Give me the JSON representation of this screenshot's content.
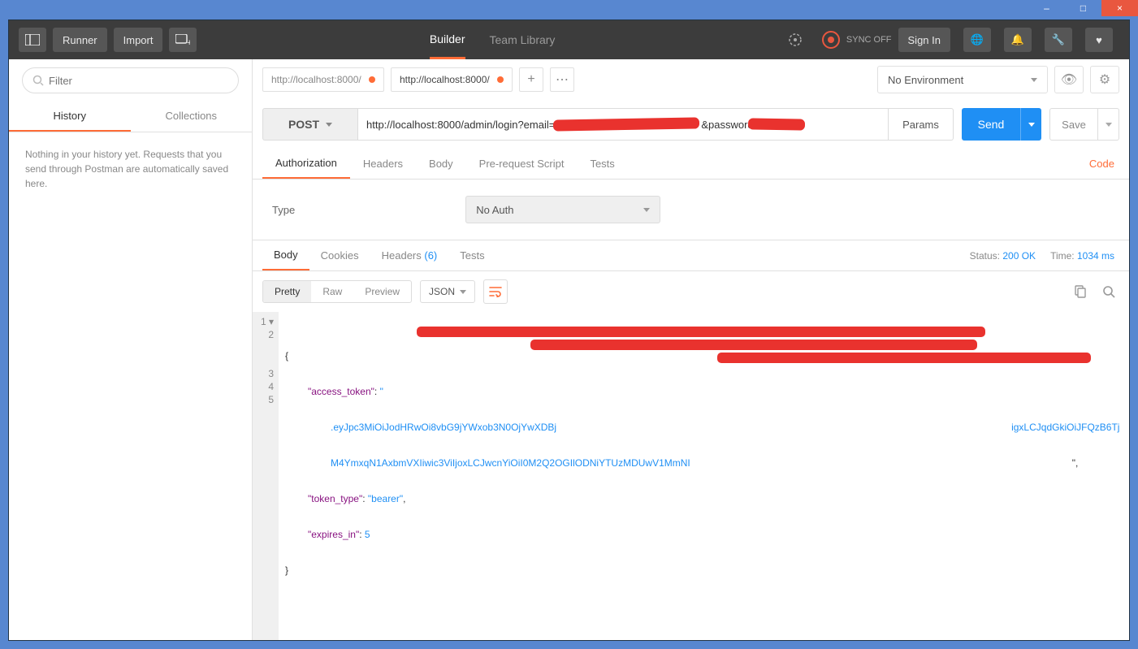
{
  "window_controls": {
    "minimize": "–",
    "maximize": "□",
    "close": "×"
  },
  "toolbar": {
    "runner_label": "Runner",
    "import_label": "Import",
    "builder_label": "Builder",
    "team_library_label": "Team Library",
    "sync_label": "SYNC OFF",
    "sign_in_label": "Sign In"
  },
  "sidebar": {
    "filter_placeholder": "Filter",
    "history_label": "History",
    "collections_label": "Collections",
    "empty_text": "Nothing in your history yet. Requests that you send through Postman are automatically saved here."
  },
  "request_tabs": [
    {
      "title": "http://localhost:8000/",
      "dirty": true,
      "active": false
    },
    {
      "title": "http://localhost:8000/",
      "dirty": true,
      "active": true
    }
  ],
  "environment": {
    "selected": "No Environment"
  },
  "request": {
    "method": "POST",
    "url_prefix": "http://localhost:8000/admin/login?email=",
    "url_mid": "&password=",
    "params_label": "Params",
    "send_label": "Send",
    "save_label": "Save"
  },
  "request_subtabs": {
    "authorization": "Authorization",
    "headers": "Headers",
    "body": "Body",
    "prerequest": "Pre-request Script",
    "tests": "Tests",
    "code": "Code"
  },
  "auth": {
    "type_label": "Type",
    "selected": "No Auth"
  },
  "response_tabs": {
    "body": "Body",
    "cookies": "Cookies",
    "headers": "Headers",
    "headers_count": "(6)",
    "tests": "Tests"
  },
  "response_status": {
    "status_label": "Status:",
    "status_value": "200 OK",
    "time_label": "Time:",
    "time_value": "1034 ms"
  },
  "body_toolbar": {
    "pretty": "Pretty",
    "raw": "Raw",
    "preview": "Preview",
    "format": "JSON"
  },
  "response_body": {
    "line1_brace": "{",
    "line2_key": "\"access_token\"",
    "line2_sep": ": ",
    "line2_valpfx": "\"",
    "line3_frag1": ".eyJpc3MiOiJodHRwOi8vbG9jYWxob3N0OjYwXDBj",
    "line3_frag2": "igxLCJqdGkiOiJFQzB6Tj",
    "line4_frag": "M4YmxqN1AxbmVXIiwic3ViIjoxLCJwcnYiOiI0M2Q2OGIlODNiYTUzMDUwV1MmNI",
    "line4_end": "\",",
    "line5_key": "\"token_type\"",
    "line5_val": "\"bearer\"",
    "line5_comma": ",",
    "line6_key": "\"expires_in\"",
    "line6_val": "5",
    "line7_brace": "}",
    "gutter": [
      "1 ▾",
      "2",
      "",
      "",
      "3",
      "4",
      "5"
    ]
  }
}
